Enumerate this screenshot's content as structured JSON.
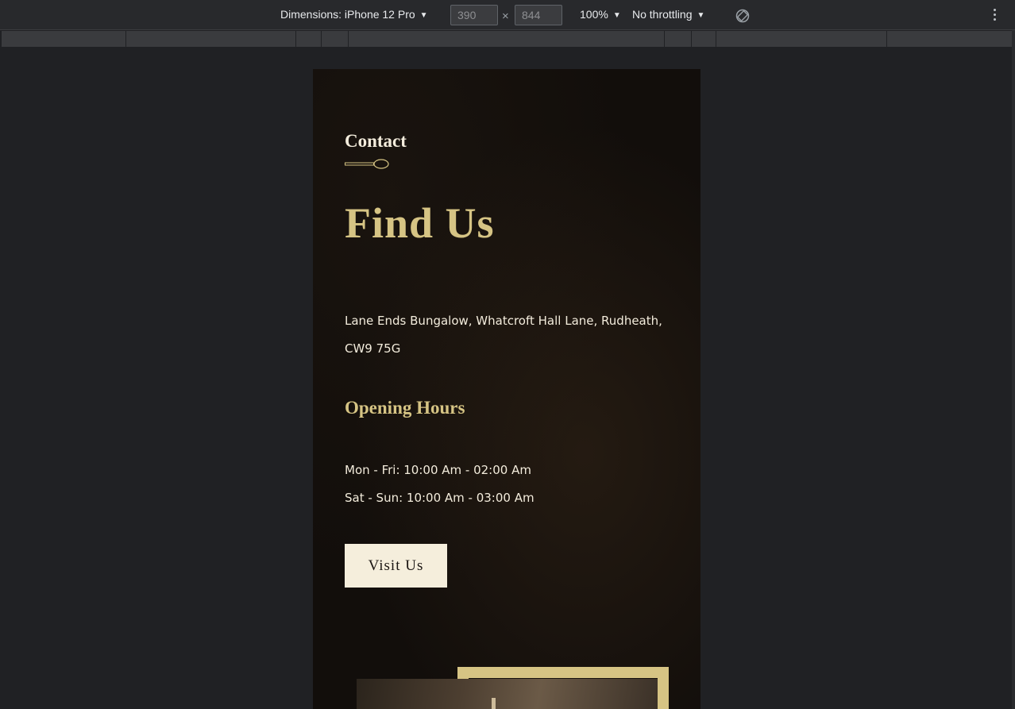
{
  "devtools": {
    "dimensions_label": "Dimensions: iPhone 12 Pro",
    "width_value": "390",
    "height_value": "844",
    "times": "×",
    "zoom": "100%",
    "throttling": "No throttling"
  },
  "page": {
    "eyebrow": "Contact",
    "headline": "Find Us",
    "address_line1": "Lane Ends Bungalow, Whatcroft Hall Lane, Rudheath,",
    "address_line2": "CW9 75G",
    "hours_title": "Opening Hours",
    "hours_weekday": "Mon - Fri: 10:00 Am - 02:00 Am",
    "hours_weekend": "Sat - Sun: 10:00 Am - 03:00 Am",
    "cta_label": "Visit Us"
  },
  "colors": {
    "accent_gold": "#d6c484",
    "cream": "#f5eedc",
    "background": "#120e0b"
  }
}
